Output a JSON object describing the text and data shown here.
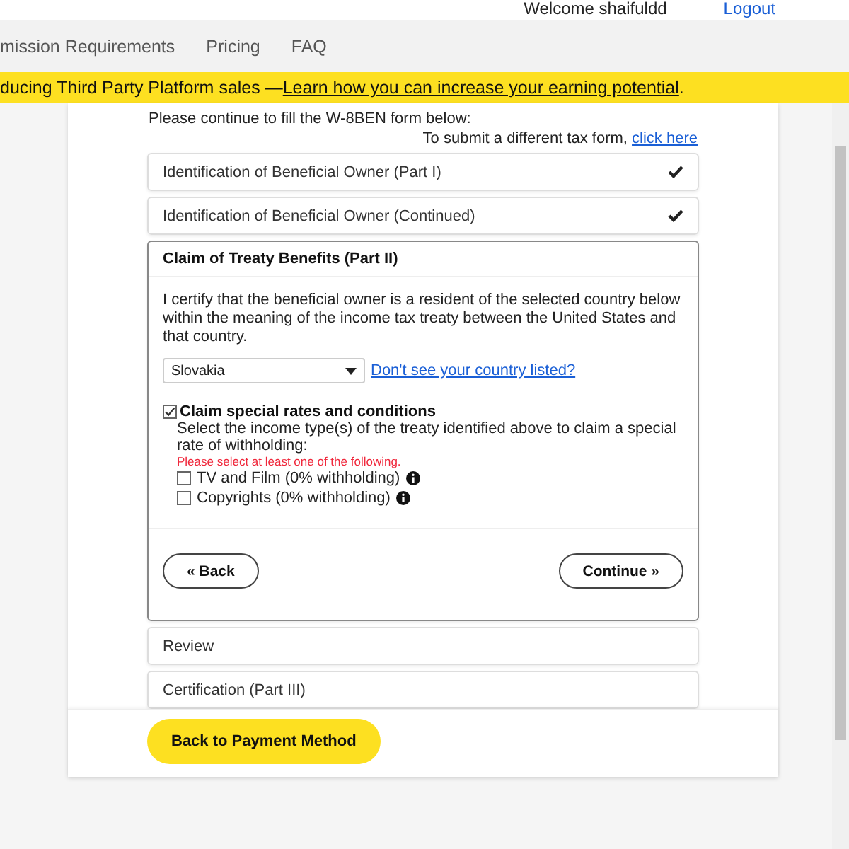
{
  "header": {
    "welcome": "Welcome shaifuldd",
    "logout": "Logout"
  },
  "nav": [
    "mission Requirements",
    "Pricing",
    "FAQ"
  ],
  "banner": {
    "text": "ducing Third Party Platform sales — ",
    "link": "Learn how you can increase your earning potential",
    "end": "."
  },
  "intro": "Please continue to fill the W-8BEN form below:",
  "different_form": {
    "text": "To submit a different tax form, ",
    "link": "click here"
  },
  "steps": [
    {
      "title": "Identification of Beneficial Owner (Part I)",
      "completed": true,
      "expanded": false
    },
    {
      "title": "Identification of Beneficial Owner (Continued)",
      "completed": true,
      "expanded": false
    },
    {
      "title": "Claim of Treaty Benefits (Part II)",
      "completed": false,
      "expanded": true
    },
    {
      "title": "Review",
      "completed": false,
      "expanded": false
    },
    {
      "title": "Certification (Part III)",
      "completed": false,
      "expanded": false
    }
  ],
  "treaty": {
    "certify": "I certify that the beneficial owner is a resident of the selected country below within the meaning of the income tax treaty between the United States and that country.",
    "country": "Slovakia",
    "country_link": "Don't see your country listed?",
    "claim": {
      "label": "Claim special rates and conditions",
      "checked": true
    },
    "instructions": "Select the income type(s) of the treaty identified above to claim a special rate of withholding:",
    "error": "Please select at least one of the following.",
    "options": [
      {
        "label": "TV and Film (0% withholding)",
        "checked": false
      },
      {
        "label": "Copyrights (0% withholding)",
        "checked": false
      }
    ],
    "back": "« Back",
    "continue": "Continue »"
  },
  "payment_button": "Back to Payment Method"
}
